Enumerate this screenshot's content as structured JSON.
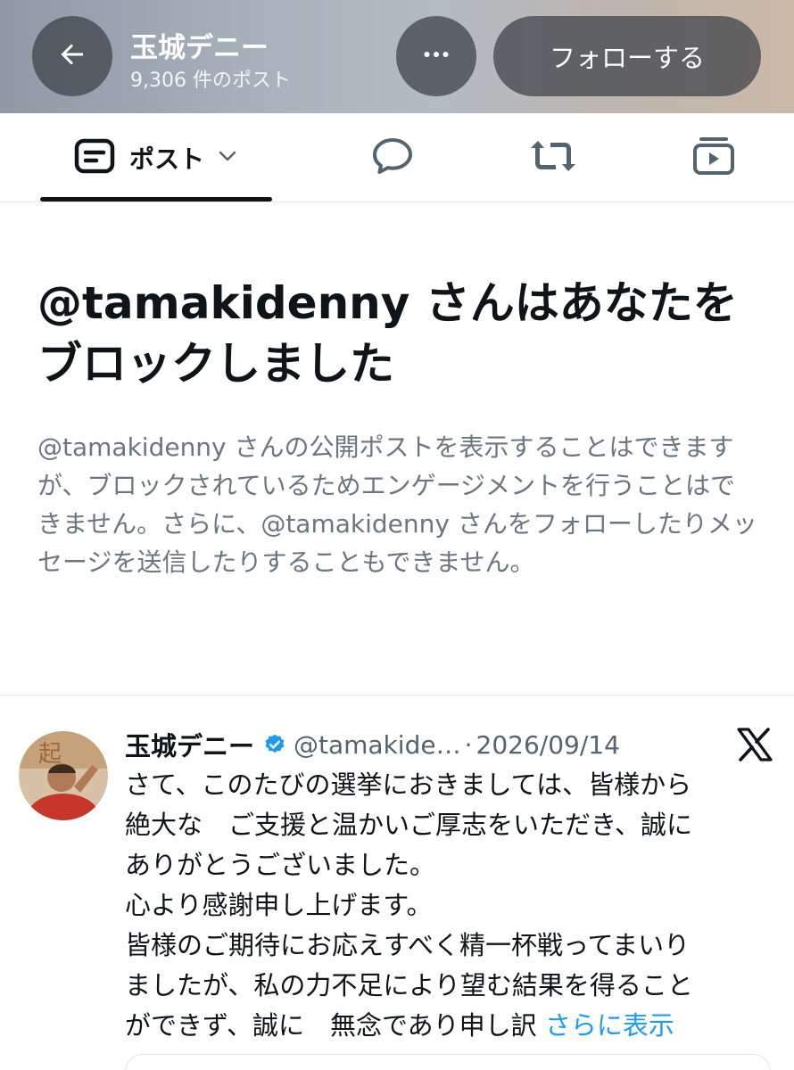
{
  "header": {
    "title": "玉城デニー",
    "post_count": "9,306 件のポスト",
    "follow_label": "フォローする"
  },
  "tabs": {
    "posts_label": "ポスト"
  },
  "blocked": {
    "title": "@tamakidenny さんはあなたをブロックしました",
    "description": "@tamakidenny さんの公開ポストを表示することはできますが、ブロックされているためエンゲージメントを行うことはできません。さらに、@tamakidenny さんをフォローしたりメッセージを送信したりすることもできません。"
  },
  "tweet": {
    "name": "玉城デニー",
    "handle": "@tamakide…",
    "separator": "·",
    "date": "2026/09/14",
    "lines": [
      "さて、このたびの選挙におきましては、皆様から",
      "絶大な　ご支援と温かいご厚志をいただき、誠に",
      "ありがとうございました。",
      "心より感謝申し上げます。",
      "皆様のご期待にお応えすべく精一杯戦ってまいり",
      "ましたが、私の力不足により望む結果を得ること"
    ],
    "last_line": "ができず、誠に　無念であり申し訳",
    "show_more": "さらに表示"
  },
  "colors": {
    "accent": "#1d9bf0",
    "text_primary": "#0f1419",
    "text_secondary": "#536471",
    "verified": "#1d9bf0"
  },
  "icons": [
    "back-arrow-icon",
    "more-icon",
    "post-format-icon",
    "chevron-down-icon",
    "reply-icon",
    "repost-icon",
    "media-icon",
    "verified-badge-icon",
    "x-logo-icon"
  ]
}
